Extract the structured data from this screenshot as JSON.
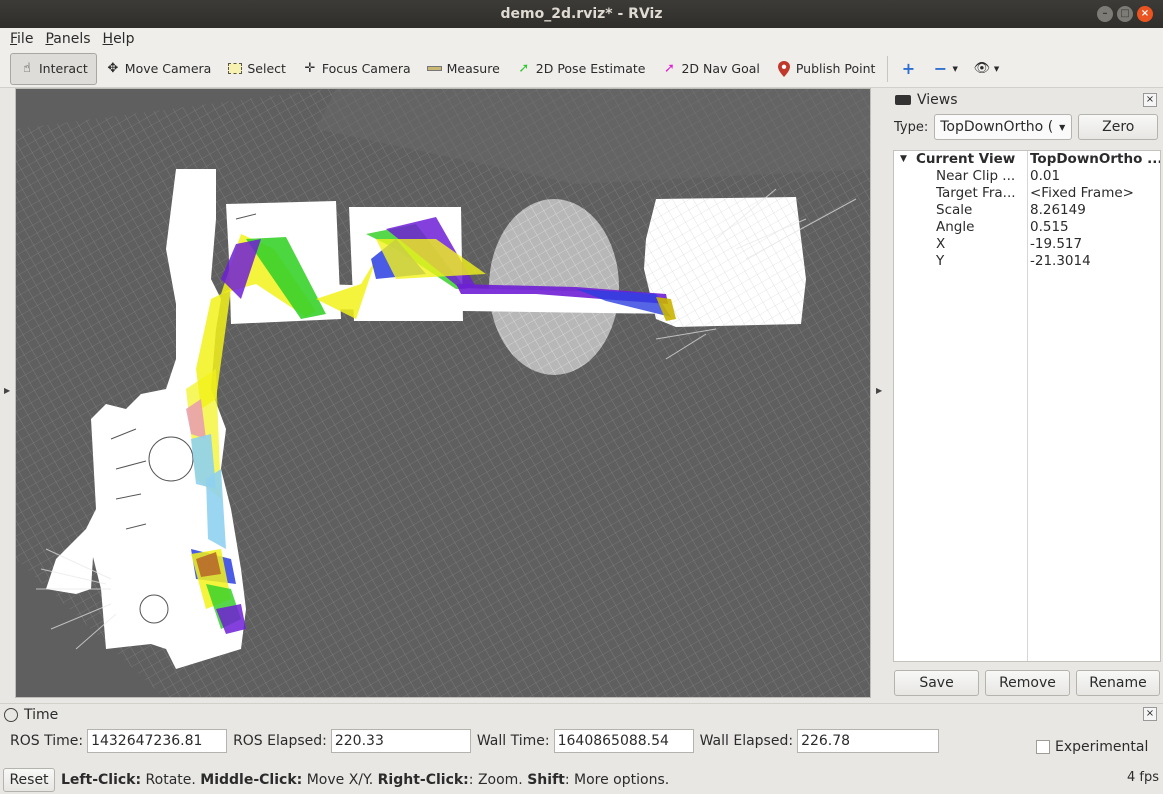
{
  "window": {
    "title": "demo_2d.rviz* - RViz"
  },
  "menu": [
    {
      "accel": "F",
      "rest": "ile"
    },
    {
      "accel": "P",
      "rest": "anels"
    },
    {
      "accel": "H",
      "rest": "elp"
    }
  ],
  "toolbar": {
    "interact": "Interact",
    "move_camera": "Move Camera",
    "select": "Select",
    "focus_camera": "Focus Camera",
    "measure": "Measure",
    "pose_estimate": "2D Pose Estimate",
    "nav_goal": "2D Nav Goal",
    "publish_point": "Publish Point"
  },
  "views": {
    "title": "Views",
    "type_label": "Type:",
    "type_value": "TopDownOrtho (",
    "zero_label": "Zero",
    "current_view_label": "Current View",
    "current_view_value": "TopDownOrtho ...",
    "props": [
      {
        "k": "Near Clip ...",
        "v": "0.01"
      },
      {
        "k": "Target Fra...",
        "v": "<Fixed Frame>"
      },
      {
        "k": "Scale",
        "v": "8.26149"
      },
      {
        "k": "Angle",
        "v": "0.515"
      },
      {
        "k": "X",
        "v": "-19.517"
      },
      {
        "k": "Y",
        "v": "-21.3014"
      }
    ],
    "save": "Save",
    "remove": "Remove",
    "rename": "Rename"
  },
  "time": {
    "title": "Time",
    "ros_time_label": "ROS Time:",
    "ros_time": "1432647236.81",
    "ros_elapsed_label": "ROS Elapsed:",
    "ros_elapsed": "220.33",
    "wall_time_label": "Wall Time:",
    "wall_time": "1640865088.54",
    "wall_elapsed_label": "Wall Elapsed:",
    "wall_elapsed": "226.78",
    "experimental": "Experimental"
  },
  "status": {
    "reset": "Reset",
    "left_click": "Left-Click:",
    "left_desc": " Rotate. ",
    "middle_click": "Middle-Click:",
    "middle_desc": " Move X/Y. ",
    "right_click": "Right-Click:",
    "right_desc": ": Zoom. ",
    "shift": "Shift",
    "shift_desc": ": More options.",
    "fps": "4 fps"
  },
  "colors": {
    "map_free": "#ffffff",
    "map_unknown": "#5f5f5f",
    "path_green": "#39d12a",
    "path_purple": "#6f1fd6",
    "path_yellow": "#f2f21a",
    "path_blue": "#2a3fe0"
  }
}
